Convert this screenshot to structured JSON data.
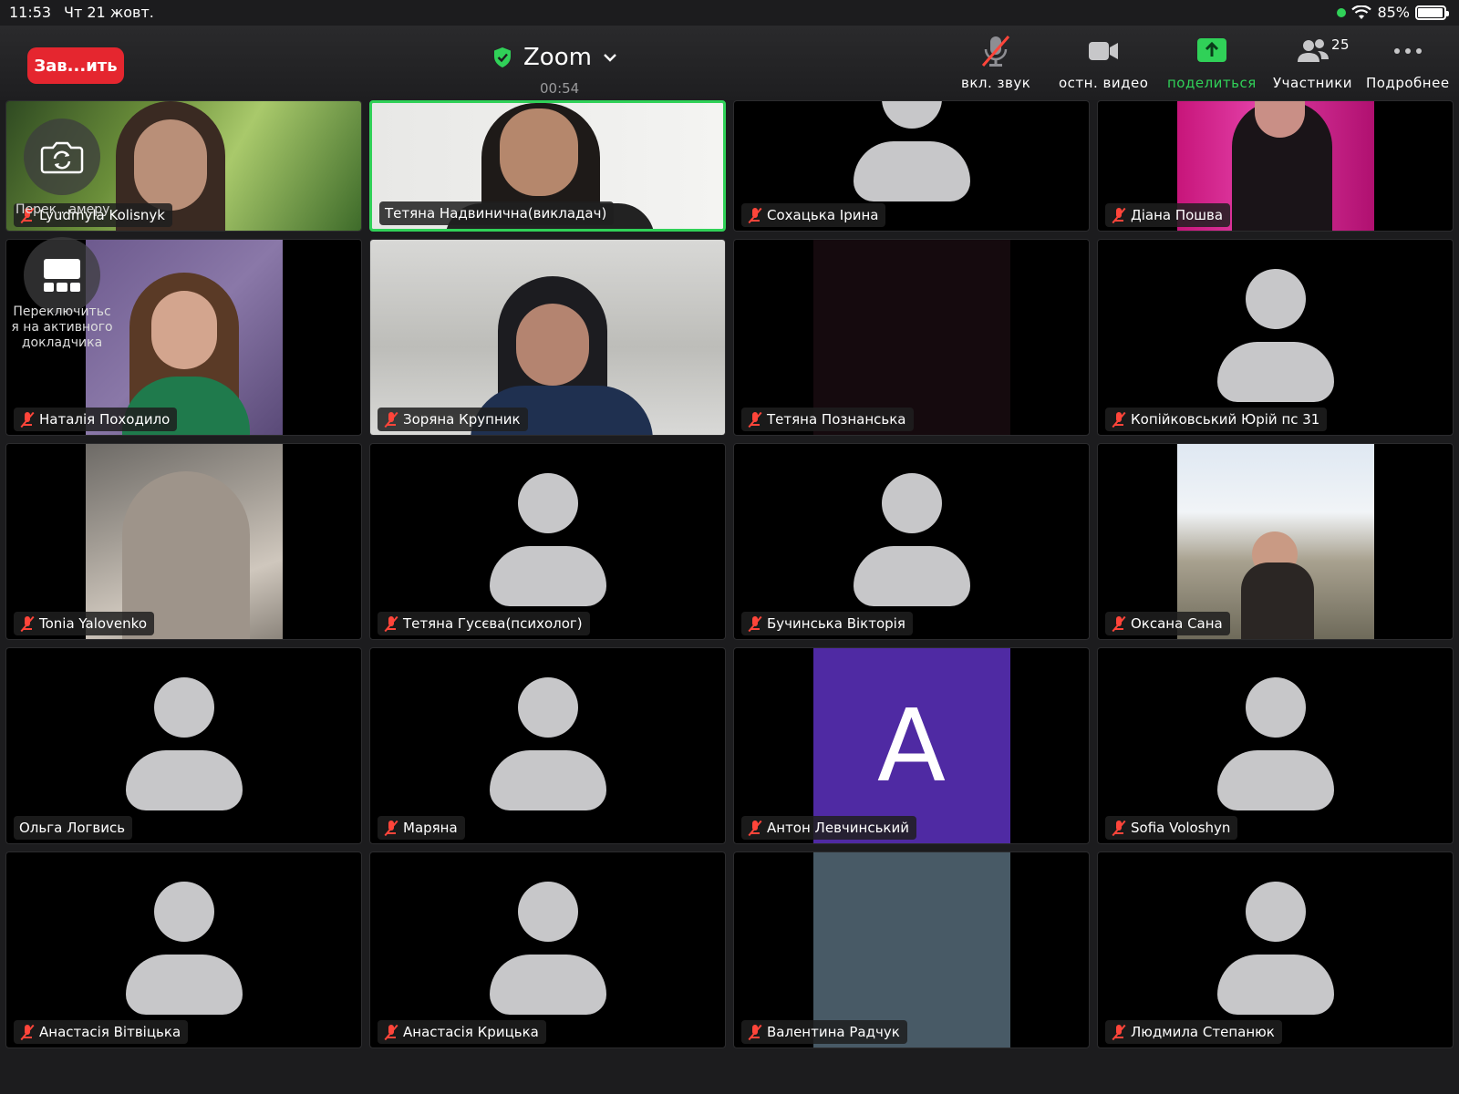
{
  "status_bar": {
    "time": "11:53",
    "date": "Чт 21 жовт.",
    "battery": "85%"
  },
  "toolbar": {
    "end_label": "Зав...ить",
    "title": "Zoom",
    "timer": "00:54",
    "buttons": {
      "audio": "вкл. звук",
      "video": "остн. видео",
      "share": "поделиться",
      "participants": "Участники",
      "participants_count": "25",
      "more": "Подробнее"
    }
  },
  "overlays": {
    "switch_camera_label": "Перек...амеру",
    "switch_view_label": "Переключитьс я на активного докладчика"
  },
  "participants": [
    {
      "name": "Lyudmyla Kolisnyk",
      "muted": true
    },
    {
      "name": "Тетяна Надвинична(викладач)",
      "muted": false
    },
    {
      "name": "Сохацька Ірина",
      "muted": true
    },
    {
      "name": "Діана Пошва",
      "muted": true
    },
    {
      "name": "Наталія Походило",
      "muted": true
    },
    {
      "name": "Зоряна Крупник",
      "muted": true
    },
    {
      "name": "Тетяна Познанська",
      "muted": true
    },
    {
      "name": "Копійковський Юрій пс 31",
      "muted": true
    },
    {
      "name": "Tonia Yalovenko",
      "muted": true
    },
    {
      "name": "Тетяна Гусєва(психолог)",
      "muted": true
    },
    {
      "name": "Бучинська Вікторія",
      "muted": true
    },
    {
      "name": "Оксана Сана",
      "muted": true
    },
    {
      "name": "Ольга Логвись",
      "muted": false
    },
    {
      "name": "Маряна",
      "muted": true
    },
    {
      "name": "Антон Левчинський",
      "muted": true,
      "avatar_letter": "A",
      "avatar_color": "#4f2aa3"
    },
    {
      "name": "Sofia Voloshyn",
      "muted": true
    },
    {
      "name": "Анастасія Вітвіцька",
      "muted": true
    },
    {
      "name": "Анастасія Крицька",
      "muted": true
    },
    {
      "name": "Валентина Радчук",
      "muted": true
    },
    {
      "name": "Людмила Степанюк",
      "muted": true
    }
  ],
  "colors": {
    "accent_green": "#30d158",
    "end_red": "#e5262f",
    "muted_red": "#ff453a"
  }
}
